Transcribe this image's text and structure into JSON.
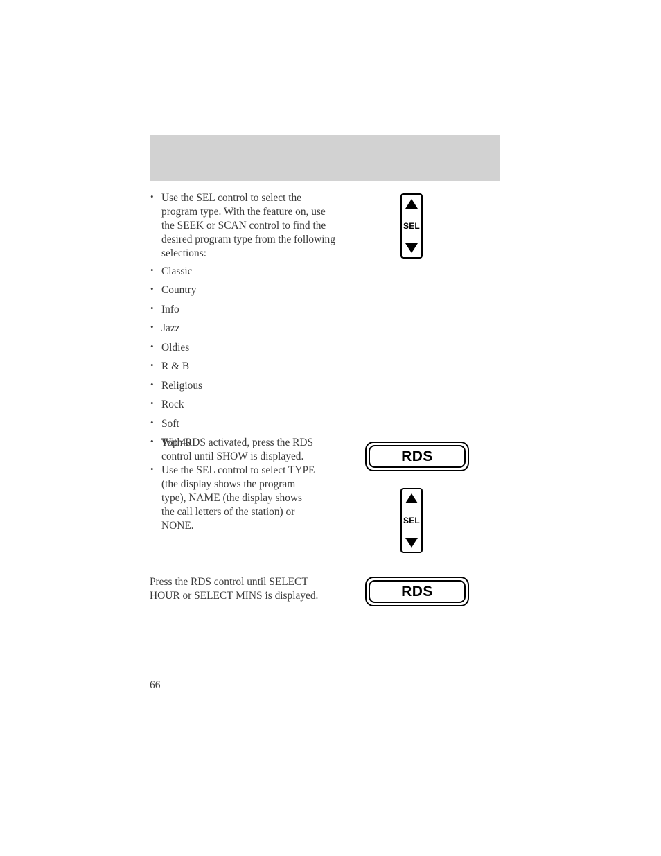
{
  "page": {
    "number": "66",
    "header_band_color": "#d2d2d2",
    "background_color": "#ffffff",
    "text_color": "#3a3a3a"
  },
  "sections": [
    {
      "id": "program-type-selection",
      "bullets": [
        "Use the SEL control to select the program type. With the feature on, use the SEEK or SCAN control to find the desired program type from the following selections:"
      ],
      "control": {
        "type": "sel-rocker",
        "label": "SEL",
        "up_arrow": "▲",
        "down_arrow": "▼"
      }
    },
    {
      "id": "program-type-options",
      "options": [
        "Classic",
        "Country",
        "Info",
        "Jazz",
        "Oldies",
        "R & B",
        "Religious",
        "Rock",
        "Soft",
        "Top 40"
      ]
    },
    {
      "id": "rds-show-display",
      "bullets": [
        "With RDS activated, press the RDS control until SHOW is displayed.",
        "Use the SEL control to select TYPE (the display shows the program type), NAME (the display shows the call letters of the station) or NONE."
      ],
      "controls": [
        {
          "type": "rds-button",
          "label": "RDS"
        },
        {
          "type": "sel-rocker",
          "label": "SEL",
          "up_arrow": "▲",
          "down_arrow": "▼"
        }
      ]
    },
    {
      "id": "rds-clock-set",
      "paragraph": "Press the RDS control until SELECT HOUR or SELECT MINS is displayed.",
      "control": {
        "type": "rds-button",
        "label": "RDS"
      }
    }
  ]
}
